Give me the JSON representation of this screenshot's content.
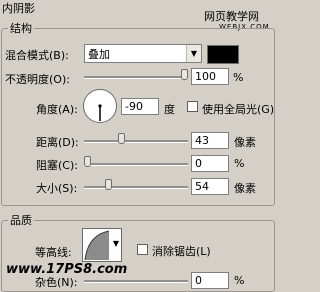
{
  "panel": {
    "title": "内阴影",
    "structure_label": "结构",
    "quality_label": "品质"
  },
  "blend": {
    "label": "混合模式(B):",
    "value": "叠加",
    "color": "#000000"
  },
  "opacity": {
    "label": "不透明度(O):",
    "value": "100",
    "unit": "%",
    "fraction": 1.0
  },
  "angle": {
    "label": "角度(A):",
    "value": "-90",
    "unit": "度",
    "global_light_label": "使用全局光(G)"
  },
  "distance": {
    "label": "距离(D):",
    "value": "43",
    "unit": "像素",
    "fraction": 0.35
  },
  "choke": {
    "label": "阻塞(C):",
    "value": "0",
    "unit": "%",
    "fraction": 0.0
  },
  "size": {
    "label": "大小(S):",
    "value": "54",
    "unit": "像素",
    "fraction": 0.22
  },
  "contour": {
    "label": "等高线:",
    "antialias_label": "消除锯齿(L)"
  },
  "noise": {
    "label": "杂色(N):",
    "value": "0",
    "unit": "%"
  },
  "watermark": {
    "line1": "网页教学网",
    "line2": "WEBJX.COM",
    "line3": "www.17PS8.com"
  }
}
